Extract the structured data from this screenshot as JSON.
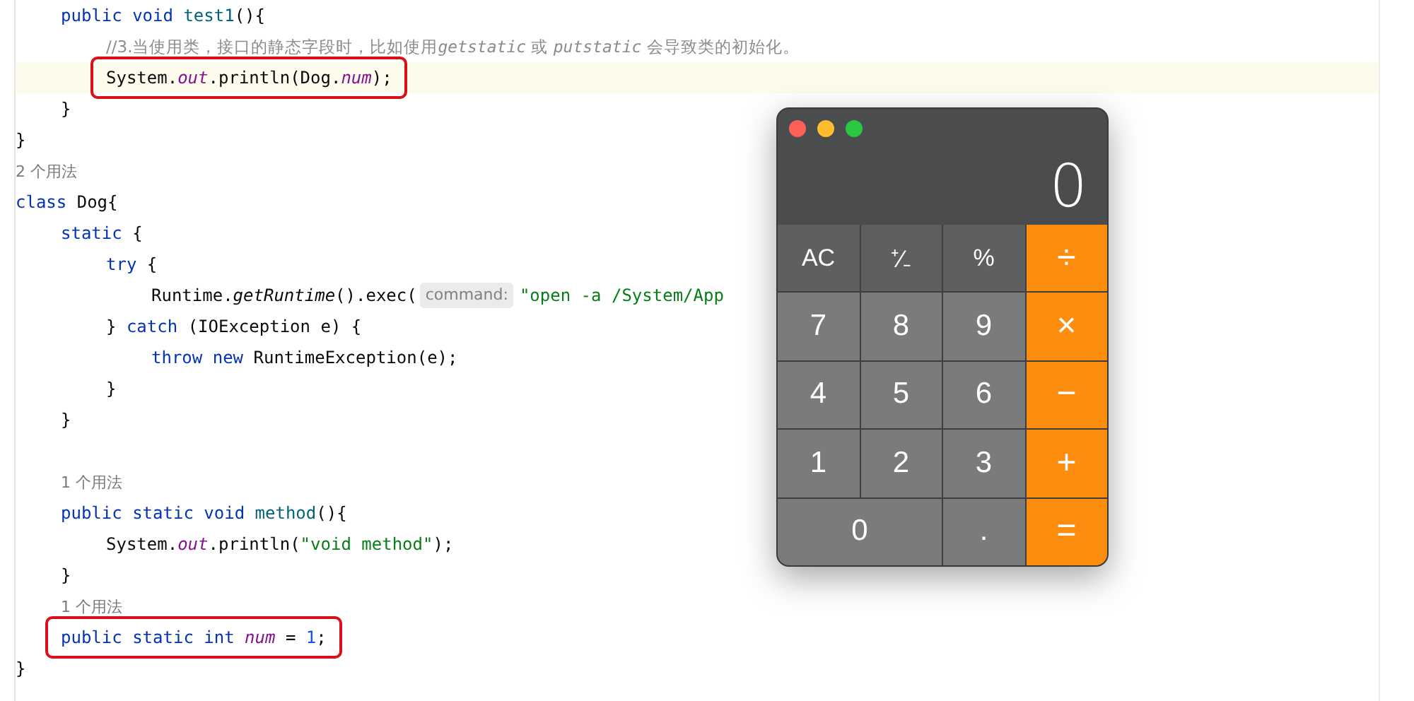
{
  "editor": {
    "lines": [
      {
        "kind": "code",
        "tokens": [
          {
            "kind": "keyword",
            "text": "public void "
          },
          {
            "kind": "method",
            "text": "test1"
          },
          {
            "kind": "plain",
            "text": "(){"
          }
        ]
      },
      {
        "kind": "code",
        "tokens": [
          {
            "kind": "comment",
            "text": "//3.当使用类，接口的静态字段时，比如使用"
          },
          {
            "kind": "comment-italic",
            "text": "getstatic"
          },
          {
            "kind": "comment",
            "text": " 或 "
          },
          {
            "kind": "comment-italic",
            "text": "putstatic"
          },
          {
            "kind": "comment",
            "text": " 会导致类的初始化。"
          }
        ]
      },
      {
        "kind": "code",
        "current": true,
        "boxed": true,
        "tokens": [
          {
            "kind": "plain",
            "text": "System."
          },
          {
            "kind": "field",
            "text": "out"
          },
          {
            "kind": "plain",
            "text": ".println(Dog."
          },
          {
            "kind": "field",
            "text": "num"
          },
          {
            "kind": "plain",
            "text": ");"
          }
        ]
      },
      {
        "kind": "code",
        "tokens": [
          {
            "kind": "plain",
            "text": "}"
          }
        ]
      },
      {
        "kind": "code",
        "tokens": [
          {
            "kind": "plain",
            "text": "}"
          }
        ]
      },
      {
        "kind": "usage",
        "text": "2 个用法"
      },
      {
        "kind": "code",
        "tokens": [
          {
            "kind": "keyword",
            "text": "class "
          },
          {
            "kind": "plain",
            "text": "Dog{"
          }
        ]
      },
      {
        "kind": "code",
        "tokens": [
          {
            "kind": "keyword",
            "text": "static "
          },
          {
            "kind": "plain",
            "text": "{"
          }
        ]
      },
      {
        "kind": "code",
        "tokens": [
          {
            "kind": "keyword",
            "text": "try "
          },
          {
            "kind": "plain",
            "text": "{"
          }
        ]
      },
      {
        "kind": "code",
        "tokens": [
          {
            "kind": "plain",
            "text": "Runtime."
          },
          {
            "kind": "italic",
            "text": "getRuntime"
          },
          {
            "kind": "plain",
            "text": "().exec("
          },
          {
            "kind": "hint",
            "text": "command:"
          },
          {
            "kind": "string",
            "text": "\"open -a /System/App"
          }
        ]
      },
      {
        "kind": "code",
        "tokens": [
          {
            "kind": "plain",
            "text": "} "
          },
          {
            "kind": "keyword",
            "text": "catch "
          },
          {
            "kind": "plain",
            "text": "(IOException e) {"
          }
        ]
      },
      {
        "kind": "code",
        "tokens": [
          {
            "kind": "keyword",
            "text": "throw new "
          },
          {
            "kind": "plain",
            "text": "RuntimeException(e);"
          }
        ]
      },
      {
        "kind": "code",
        "tokens": [
          {
            "kind": "plain",
            "text": "}"
          }
        ]
      },
      {
        "kind": "code",
        "tokens": [
          {
            "kind": "plain",
            "text": "}"
          }
        ]
      },
      {
        "kind": "blank"
      },
      {
        "kind": "usage",
        "text": "1 个用法"
      },
      {
        "kind": "code",
        "tokens": [
          {
            "kind": "keyword",
            "text": "public static void "
          },
          {
            "kind": "method",
            "text": "method"
          },
          {
            "kind": "plain",
            "text": "(){"
          }
        ]
      },
      {
        "kind": "code",
        "tokens": [
          {
            "kind": "plain",
            "text": "System."
          },
          {
            "kind": "field",
            "text": "out"
          },
          {
            "kind": "plain",
            "text": ".println("
          },
          {
            "kind": "string",
            "text": "\"void method\""
          },
          {
            "kind": "plain",
            "text": ");"
          }
        ]
      },
      {
        "kind": "code",
        "tokens": [
          {
            "kind": "plain",
            "text": "}"
          }
        ]
      },
      {
        "kind": "usage",
        "text": "1 个用法"
      },
      {
        "kind": "code",
        "boxed": true,
        "tokens": [
          {
            "kind": "keyword",
            "text": "public static int "
          },
          {
            "kind": "field",
            "text": "num"
          },
          {
            "kind": "plain",
            "text": " = "
          },
          {
            "kind": "number",
            "text": "1"
          },
          {
            "kind": "plain",
            "text": ";"
          }
        ]
      },
      {
        "kind": "code",
        "tokens": [
          {
            "kind": "plain",
            "text": "}"
          }
        ]
      }
    ]
  },
  "calculator": {
    "display": "0",
    "keys": [
      {
        "label": "AC",
        "kind": "function",
        "wide": false
      },
      {
        "label": "⁺∕₋",
        "kind": "function",
        "wide": false
      },
      {
        "label": "%",
        "kind": "function",
        "wide": false
      },
      {
        "label": "÷",
        "kind": "operator",
        "wide": false
      },
      {
        "label": "7",
        "kind": "digit",
        "wide": false
      },
      {
        "label": "8",
        "kind": "digit",
        "wide": false
      },
      {
        "label": "9",
        "kind": "digit",
        "wide": false
      },
      {
        "label": "×",
        "kind": "operator",
        "wide": false
      },
      {
        "label": "4",
        "kind": "digit",
        "wide": false
      },
      {
        "label": "5",
        "kind": "digit",
        "wide": false
      },
      {
        "label": "6",
        "kind": "digit",
        "wide": false
      },
      {
        "label": "−",
        "kind": "operator",
        "wide": false
      },
      {
        "label": "1",
        "kind": "digit",
        "wide": false
      },
      {
        "label": "2",
        "kind": "digit",
        "wide": false
      },
      {
        "label": "3",
        "kind": "digit",
        "wide": false
      },
      {
        "label": "+",
        "kind": "operator",
        "wide": false
      },
      {
        "label": "0",
        "kind": "digit",
        "wide": true
      },
      {
        "label": ".",
        "kind": "digit",
        "wide": false
      },
      {
        "label": "=",
        "kind": "operator",
        "wide": false
      }
    ]
  }
}
